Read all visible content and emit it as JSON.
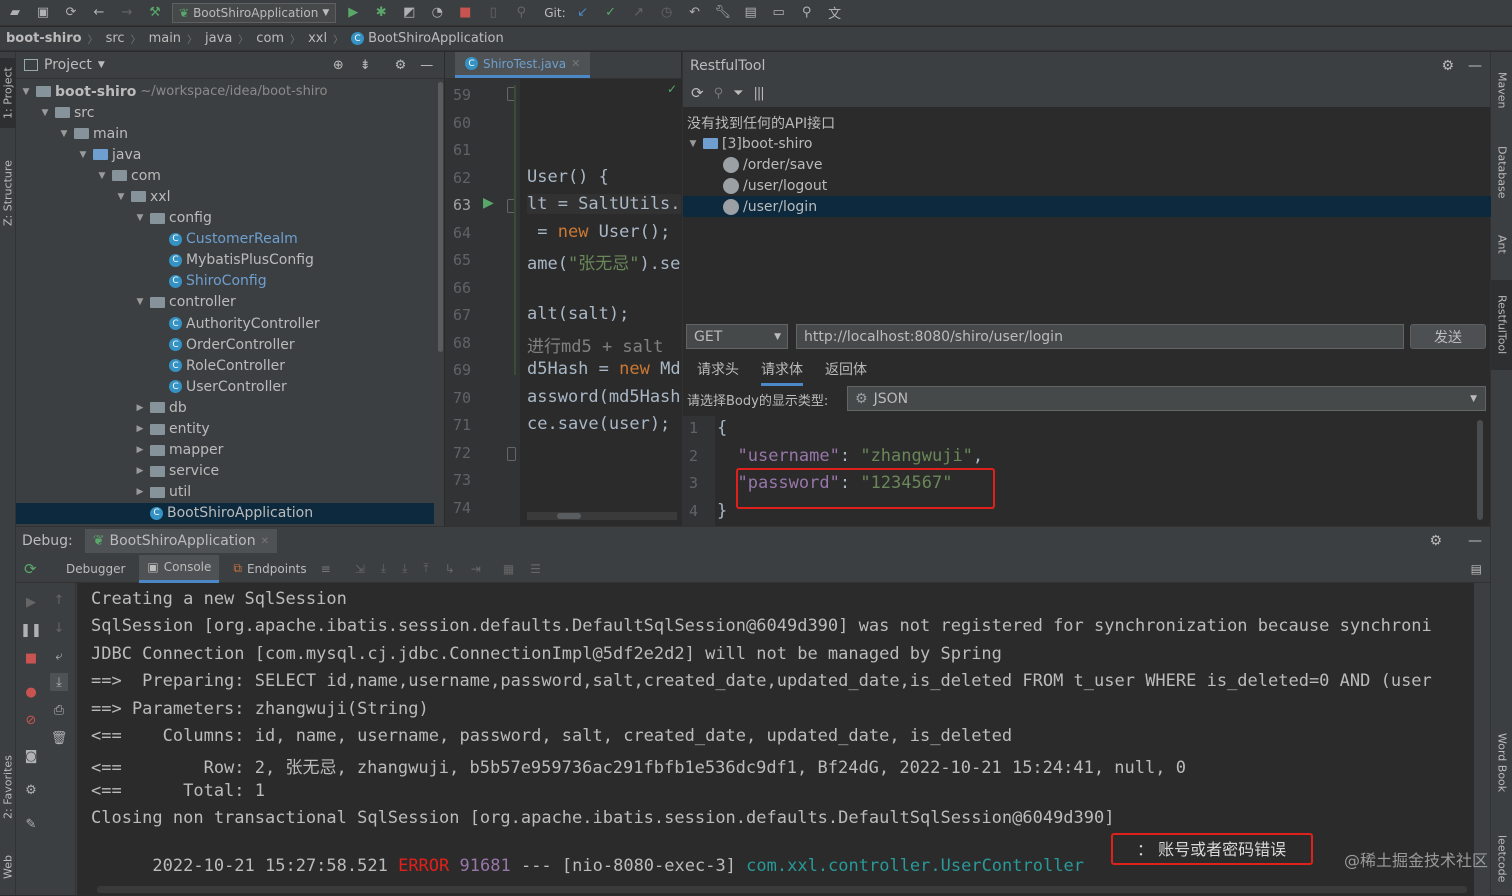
{
  "toolbar": {
    "run_config": "BootShiroApplication",
    "git_label": "Git:"
  },
  "breadcrumb": [
    "boot-shiro",
    "src",
    "main",
    "java",
    "com",
    "xxl",
    "BootShiroApplication"
  ],
  "left_strip": {
    "project": "1: Project",
    "structure": "Z: Structure",
    "favorites": "2: Favorites",
    "web": "Web"
  },
  "right_strip": {
    "maven": "Maven",
    "database": "Database",
    "ant": "Ant",
    "restfultool": "RestfulTool",
    "wordbook": "Word Book",
    "leetcode": "leetcode"
  },
  "project": {
    "title": "Project",
    "root_name": "boot-shiro",
    "root_path": "~/workspace/idea/boot-shiro",
    "tree": [
      {
        "label": "src",
        "kind": "folder",
        "expanded": true
      },
      {
        "label": "main",
        "kind": "folder",
        "expanded": true
      },
      {
        "label": "java",
        "kind": "folder-blue",
        "expanded": true
      },
      {
        "label": "com",
        "kind": "folder",
        "expanded": true
      },
      {
        "label": "xxl",
        "kind": "folder",
        "expanded": true
      },
      {
        "label": "config",
        "kind": "folder",
        "expanded": true
      },
      {
        "label": "CustomerRealm",
        "kind": "class-blue"
      },
      {
        "label": "MybatisPlusConfig",
        "kind": "class"
      },
      {
        "label": "ShiroConfig",
        "kind": "class-blue"
      },
      {
        "label": "controller",
        "kind": "folder",
        "expanded": true
      },
      {
        "label": "AuthorityController",
        "kind": "class"
      },
      {
        "label": "OrderController",
        "kind": "class"
      },
      {
        "label": "RoleController",
        "kind": "class"
      },
      {
        "label": "UserController",
        "kind": "class"
      },
      {
        "label": "db",
        "kind": "folder",
        "expanded": false
      },
      {
        "label": "entity",
        "kind": "folder",
        "expanded": false
      },
      {
        "label": "mapper",
        "kind": "folder",
        "expanded": false
      },
      {
        "label": "service",
        "kind": "folder",
        "expanded": false
      },
      {
        "label": "util",
        "kind": "folder",
        "expanded": false
      },
      {
        "label": "BootShiroApplication",
        "kind": "class-app",
        "selected": true
      }
    ]
  },
  "editor": {
    "tab": "ShiroTest.java",
    "line_numbers": [
      "59",
      "60",
      "61",
      "62",
      "63",
      "64",
      "65",
      "66",
      "67",
      "68",
      "69",
      "70",
      "71",
      "72",
      "73",
      "74"
    ],
    "lines": [
      "",
      "",
      "",
      "User() {",
      "lt = SaltUtils.",
      " = new User();",
      "ame(\"张无忌\").se",
      "",
      "alt(salt);",
      "进行md5 + salt ",
      "d5Hash = new Md",
      "assword(md5Hash",
      "ce.save(user);",
      "",
      "",
      ""
    ]
  },
  "restful": {
    "title": "RestfulTool",
    "no_api": "没有找到任何的API接口",
    "module": "[3]boot-shiro",
    "endpoints": [
      "/order/save",
      "/user/logout",
      "/user/login"
    ],
    "selected_endpoint": "/user/login",
    "method": "GET",
    "url": "http://localhost:8080/shiro/user/login",
    "send": "发送",
    "tabs": [
      "请求头",
      "请求体",
      "返回体"
    ],
    "active_tab": "请求体",
    "body_type_label": "请选择Body的显示类型:",
    "body_type": "JSON",
    "json_lines": [
      "{",
      "  \"username\": \"zhangwuji\",",
      "  \"password\": \"1234567\"",
      "}"
    ],
    "json_line_numbers": [
      "1",
      "2",
      "3",
      "4"
    ]
  },
  "debug": {
    "title": "Debug:",
    "session": "BootShiroApplication",
    "tabs": [
      "Debugger",
      "Console",
      "Endpoints"
    ],
    "active_tab": "Console",
    "console": [
      "Creating a new SqlSession",
      "SqlSession [org.apache.ibatis.session.defaults.DefaultSqlSession@6049d390] was not registered for synchronization because synchroni",
      "JDBC Connection [com.mysql.cj.jdbc.ConnectionImpl@5df2e2d2] will not be managed by Spring",
      "==>  Preparing: SELECT id,name,username,password,salt,created_date,updated_date,is_deleted FROM t_user WHERE is_deleted=0 AND (user",
      "==> Parameters: zhangwuji(String)",
      "<==    Columns: id, name, username, password, salt, created_date, updated_date, is_deleted",
      "<==        Row: 2, 张无忌, zhangwuji, b5b57e959736ac291fbfb1e536dc9df1, Bf24dG, 2022-10-21 15:24:41, null, 0",
      "<==      Total: 1",
      "Closing non transactional SqlSession [org.apache.ibatis.session.defaults.DefaultSqlSession@6049d390]"
    ],
    "error_line": {
      "timestamp": "2022-10-21 15:27:58.521",
      "level": "ERROR",
      "pid": "91681",
      "sep": "---",
      "thread": "[nio-8080-exec-3]",
      "logger": "com.xxl.controller.UserController",
      "message": "：  账号或者密码错误"
    }
  },
  "watermark": "@稀土掘金技术社区",
  "colors": {
    "accent": "#4a88c7",
    "error": "#e0211b",
    "selection": "#0d293e",
    "string": "#6a8759",
    "keyword": "#cc7832"
  }
}
